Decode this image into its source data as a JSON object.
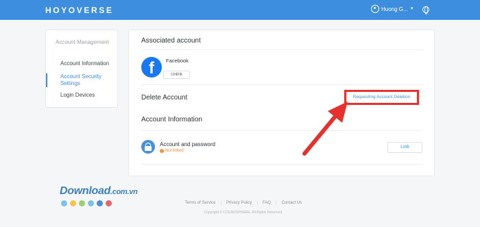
{
  "header": {
    "logo_text": "HOYOVERSE",
    "user_name": "Huong G...",
    "colors": {
      "bar": "#3e8ee0"
    }
  },
  "sidebar": {
    "heading": "Account Management",
    "items": [
      {
        "label": "Account Information",
        "active": false
      },
      {
        "label": "Account Security Settings",
        "active": true
      },
      {
        "label": "Login Devices",
        "active": false
      }
    ]
  },
  "main": {
    "associated_title": "Associated account",
    "facebook": {
      "icon_letter": "f",
      "name": "Facebook",
      "unlink_label": "Unlink"
    },
    "delete_title": "Delete Account",
    "delete_link": "Requesting Account Deletion",
    "info_title": "Account Information",
    "account": {
      "title": "Account and password",
      "status": "Not linked",
      "status_icon": "!",
      "link_label": "Link"
    }
  },
  "footer": {
    "links": [
      "Terms of Service",
      "Privacy Policy",
      "FAQ",
      "Contact Us"
    ],
    "copyright": "Copyright © COGNOSPHERE. All Rights Reserved."
  },
  "watermark": {
    "text": "Download",
    "suffix": ".com.vn",
    "dot_colors": [
      "#7fc1e6",
      "#f6c34a",
      "#9ccf6b",
      "#7fc1e6",
      "#4a8fd6",
      "#e8636a"
    ]
  },
  "annotation": {
    "highlight_color": "#e6312f"
  }
}
